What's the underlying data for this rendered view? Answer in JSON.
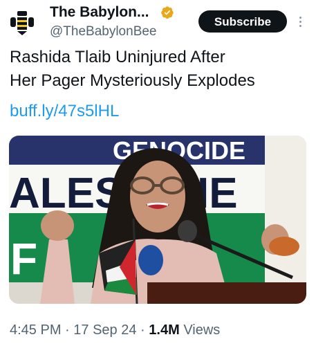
{
  "account": {
    "display_name": "The Babylon...",
    "handle": "@TheBabylonBee",
    "verified": true,
    "logo_icon": "bee-logo-icon",
    "verified_icon": "verified-badge-icon"
  },
  "actions": {
    "subscribe_label": "Subscribe",
    "more_icon": "more-options-icon"
  },
  "tweet": {
    "text_line1": "Rashida Tlaib Uninjured After",
    "text_line2": "Her Pager Mysteriously Explodes",
    "link": "buff.ly/47s5lHL"
  },
  "media": {
    "banner_text_top": "GENOCIDE",
    "banner_text_mid": "ALES",
    "banner_text_mid2": "IE",
    "banner_text_bottom": "F"
  },
  "meta": {
    "time": "4:45 PM",
    "date": "17 Sep 24",
    "views_count": "1.4M",
    "views_label": "Views",
    "sep": "·"
  },
  "colors": {
    "accent": "#1d9bf0",
    "verified_gold": "#e8a81a",
    "text_primary": "#0f1419",
    "text_secondary": "#536471"
  }
}
